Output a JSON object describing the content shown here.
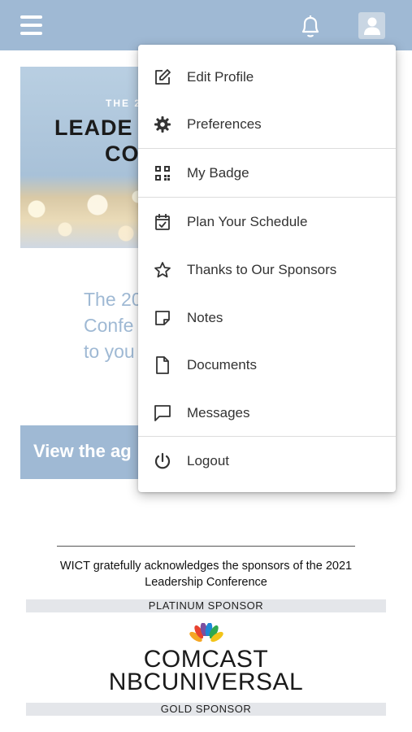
{
  "header": {
    "menu_icon": "hamburger-icon",
    "notifications_icon": "bell-icon",
    "profile_icon": "user-avatar-icon",
    "bar_color": "#9fb9d4"
  },
  "banner": {
    "small_text": "THE 2",
    "big_line1": "LEADE",
    "big_line2": "CO"
  },
  "intro": {
    "lines": [
      "The 20",
      "Confe",
      "to you"
    ]
  },
  "agenda_button": {
    "label": "View the ag"
  },
  "user_menu": {
    "items": [
      {
        "label": "Edit Profile",
        "icon": "edit-icon"
      },
      {
        "label": "Preferences",
        "icon": "gear-icon"
      },
      {
        "label": "My Badge",
        "icon": "qr-code-icon"
      },
      {
        "label": "Plan Your Schedule",
        "icon": "calendar-check-icon"
      },
      {
        "label": "Thanks to Our Sponsors",
        "icon": "star-icon"
      },
      {
        "label": "Notes",
        "icon": "note-icon"
      },
      {
        "label": "Documents",
        "icon": "document-icon"
      },
      {
        "label": "Messages",
        "icon": "message-icon"
      },
      {
        "label": "Logout",
        "icon": "power-icon"
      }
    ]
  },
  "sponsors": {
    "acknowledgement": "WICT gratefully acknowledges the sponsors of the 2021 Leadership Conference",
    "platinum_label": "PLATINUM SPONSOR",
    "platinum_sponsor": {
      "line1": "COMCAST",
      "line2": "NBCUNIVERSAL",
      "icon": "peacock-logo"
    },
    "gold_label": "GOLD SPONSOR"
  }
}
